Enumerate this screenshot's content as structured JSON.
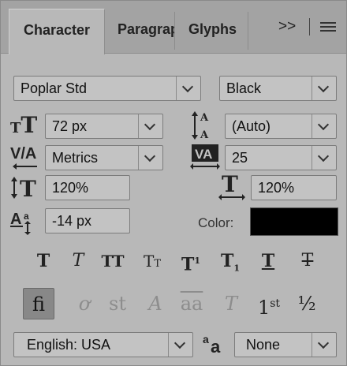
{
  "tabs": [
    {
      "label": "Character",
      "active": true
    },
    {
      "label": "Paragraph",
      "active": false
    },
    {
      "label": "Glyphs",
      "active": false
    }
  ],
  "font_family": "Poplar Std",
  "font_style": "Black",
  "font_size": "72 px",
  "leading": "(Auto)",
  "kerning": "Metrics",
  "tracking": "25",
  "vertical_scale": "120%",
  "horizontal_scale": "120%",
  "baseline_shift": "-14 px",
  "color_label": "Color:",
  "color": "#000000",
  "language": "English: USA",
  "anti_alias": "None",
  "icons": {
    "font_size": "font-size-icon",
    "leading": "leading-icon",
    "kerning": "kerning-icon",
    "tracking": "tracking-icon",
    "vertical_scale": "vertical-scale-icon",
    "horizontal_scale": "horizontal-scale-icon",
    "baseline_shift": "baseline-shift-icon",
    "anti_alias": "anti-alias-icon"
  },
  "style_buttons": [
    "faux-bold",
    "faux-italic",
    "all-caps",
    "small-caps",
    "superscript",
    "subscript",
    "underline",
    "strikethrough"
  ],
  "opentype_buttons": [
    {
      "name": "standard-ligatures",
      "enabled": true,
      "pressed": true
    },
    {
      "name": "contextual-alternates",
      "enabled": false
    },
    {
      "name": "discretionary-ligatures",
      "enabled": false
    },
    {
      "name": "swash",
      "enabled": false
    },
    {
      "name": "stylistic-alternates",
      "enabled": false
    },
    {
      "name": "titling-alternates",
      "enabled": false
    },
    {
      "name": "ordinals",
      "enabled": true
    },
    {
      "name": "fractions",
      "enabled": true
    }
  ]
}
